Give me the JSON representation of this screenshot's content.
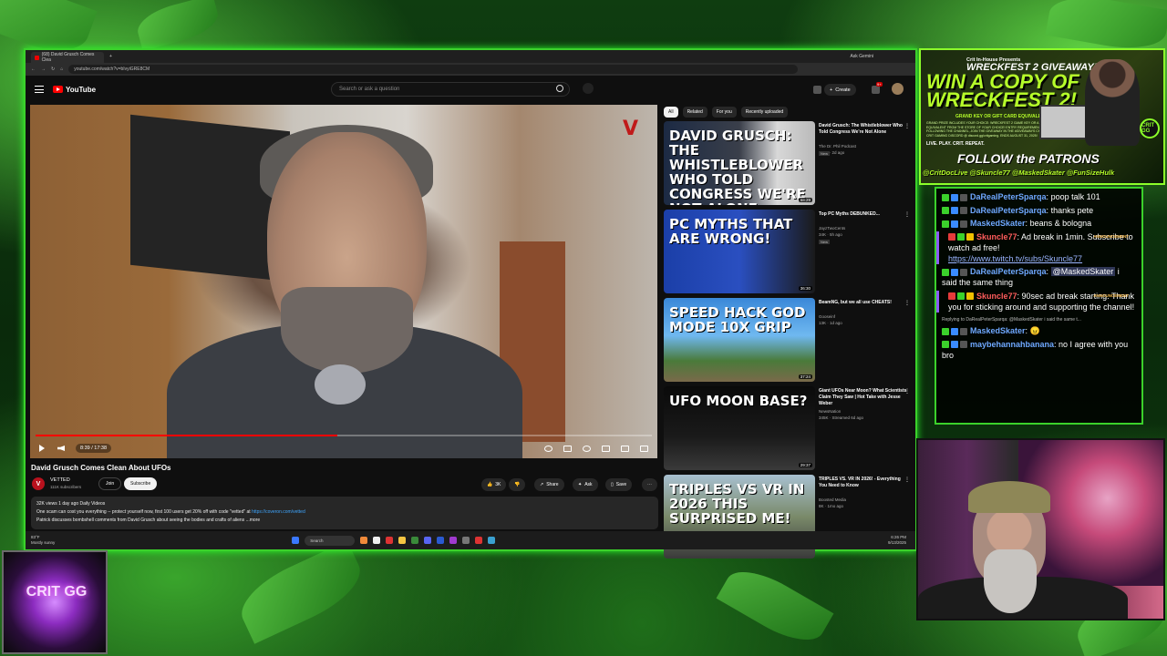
{
  "browser": {
    "tab_title": "(68) David Grusch Comes Clea",
    "ask_label": "Ask Gemini",
    "url": "youtube.com/watch?v=bIvyiGRE8CM"
  },
  "youtube": {
    "logo": "YouTube",
    "search_placeholder": "Search or ask a question",
    "create_label": "Create",
    "notif_count": "9+"
  },
  "player": {
    "time": "8:39 / 17:38",
    "progress": 0.49
  },
  "video": {
    "title": "David Grusch Comes Clean About UFOs",
    "channel": "VETTED",
    "subs": "111K subscribers",
    "channel_initial": "V",
    "join_label": "Join",
    "subscribe_label": "Subscribe",
    "likes": "3K",
    "share_label": "Share",
    "ask_label": "Ask",
    "save_label": "Save",
    "views_date": "32K views  1 day ago  Daily Videos",
    "desc_line": "One scam can cost you everything -- protect yourself now, first 100 users get 20% off with code \"vetted\" at",
    "desc_link": "https://coveron.com/vetted",
    "desc_line2": "Patrick discusses bombshell comments from David Grusch about seeing the bodies and crafts of aliens",
    "more_label": "...more"
  },
  "chips": [
    "All",
    "Related",
    "For you",
    "Recently uploaded"
  ],
  "recommendations": [
    {
      "thumb_text": "DAVID GRUSCH: THE WHISTLEBLOWER WHO TOLD CONGRESS WE'RE NOT ALONE",
      "duration": "58:29",
      "title": "David Grusch: The Whistleblower Who Told Congress We're Not Alone",
      "channel": "The Dr. Phil Podcast",
      "meta": "290K · 2d ago",
      "badge": "New"
    },
    {
      "thumb_text": "PC MYTHS THAT ARE WRONG!",
      "duration": "36:30",
      "title": "Top PC Myths DEBUNKED...",
      "channel": "JayzTwoCents",
      "meta": "34K · 5h ago",
      "badge": "New"
    },
    {
      "thumb_text": "SPEED HACK  GOD MODE  10X GRIP",
      "duration": "37:24",
      "title": "BeamNG, but we all use CHEATS!",
      "channel": "Gooseinf",
      "meta": "13K · 1d ago",
      "badge": ""
    },
    {
      "thumb_text": "UFO MOON BASE?",
      "duration": "29:37",
      "title": "Giant UFOs Near Moon? What Scientists Claim They Saw | Hot Take with Jesse Weber",
      "channel": "NewsNation",
      "meta": "345K · Streamed 6d ago",
      "badge": ""
    },
    {
      "thumb_text": "TRIPLES VS VR IN 2026 THIS SURPRISED ME!",
      "duration": "",
      "title": "TRIPLES VS. VR IN 2026! - Everything You Need to Know",
      "channel": "Boosted Media",
      "meta": "8K · 1mo ago",
      "badge": ""
    }
  ],
  "taskbar": {
    "weather_temp": "83°F",
    "weather_desc": "Mostly sunny",
    "search": "Search",
    "time": "6:26 PM",
    "date": "9/13/2025"
  },
  "promo": {
    "presents": "Crit In-House Presents",
    "giveaway": "WRECKFEST 2 GIVEAWAY!",
    "win": "WIN A COPY OF WRECKFEST 2!",
    "grand": "GRAND KEY OR GIFT CARD EQUIVALENT!",
    "fine": "GRAND PRIZE INCLUDES YOUR CHOICE: WRECKFEST 2 GAME KEY OR A GIFT CARD EQUIVALENT FROM THE STORE OF YOUR CHOICE! ENTRY REQUIREMENTS: MUST BE FOLLOWING THE CHANNEL, JOIN THE GIVEAWAY IN THE #GIVEAWAYS CHANNEL ON CRIT GAMING DISCORD @ discord.gg/critgaming. ENDS AUGUST 31, 2025!",
    "tagline": "LIVE. PLAY. CRIT. REPEAT.",
    "logo": "CRIT GG",
    "follow": "FOLLOW the PATRONS",
    "names": "@CritDocLive @Skuncle77 @MaskedSkater @FunSizeHulk"
  },
  "chat": [
    {
      "user": "DaRealPeterSparqa",
      "color": "#6fa8ff",
      "text": "poop talk 101"
    },
    {
      "user": "DaRealPeterSparqa",
      "color": "#6fa8ff",
      "text": "thanks pete"
    },
    {
      "user": "MaskedSkater",
      "color": "#6fa8ff",
      "text": "beans & bologna"
    },
    {
      "user": "Skuncle77",
      "color": "#ff5c5c",
      "text": "Ad break in 1min. Subscribe to watch ad free!",
      "link": "https://www.twitch.tv/subs/Skuncle77",
      "announcement": "ANNOUNCEMENT"
    },
    {
      "user": "DaRealPeterSparqa",
      "color": "#6fa8ff",
      "mention": "@MaskedSkater",
      "text": "i said the same thing"
    },
    {
      "user": "Skuncle77",
      "color": "#ff5c5c",
      "text": "90sec ad break starting. Thank you for sticking around and supporting the channel!",
      "announcement": "ANNOUNCEMENT"
    },
    {
      "reply": "Replying to DaRealPeterSparqa: @MaskedSkater i said the same t...",
      "user": "MaskedSkater",
      "color": "#6fa8ff",
      "text": ""
    },
    {
      "user": "maybehannahbanana",
      "color": "#6fa8ff",
      "text": "no I agree with you bro"
    }
  ],
  "corner_logo": "CRIT GG",
  "colors": {
    "accent": "#3bd12b",
    "yt_red": "#ff0000"
  }
}
